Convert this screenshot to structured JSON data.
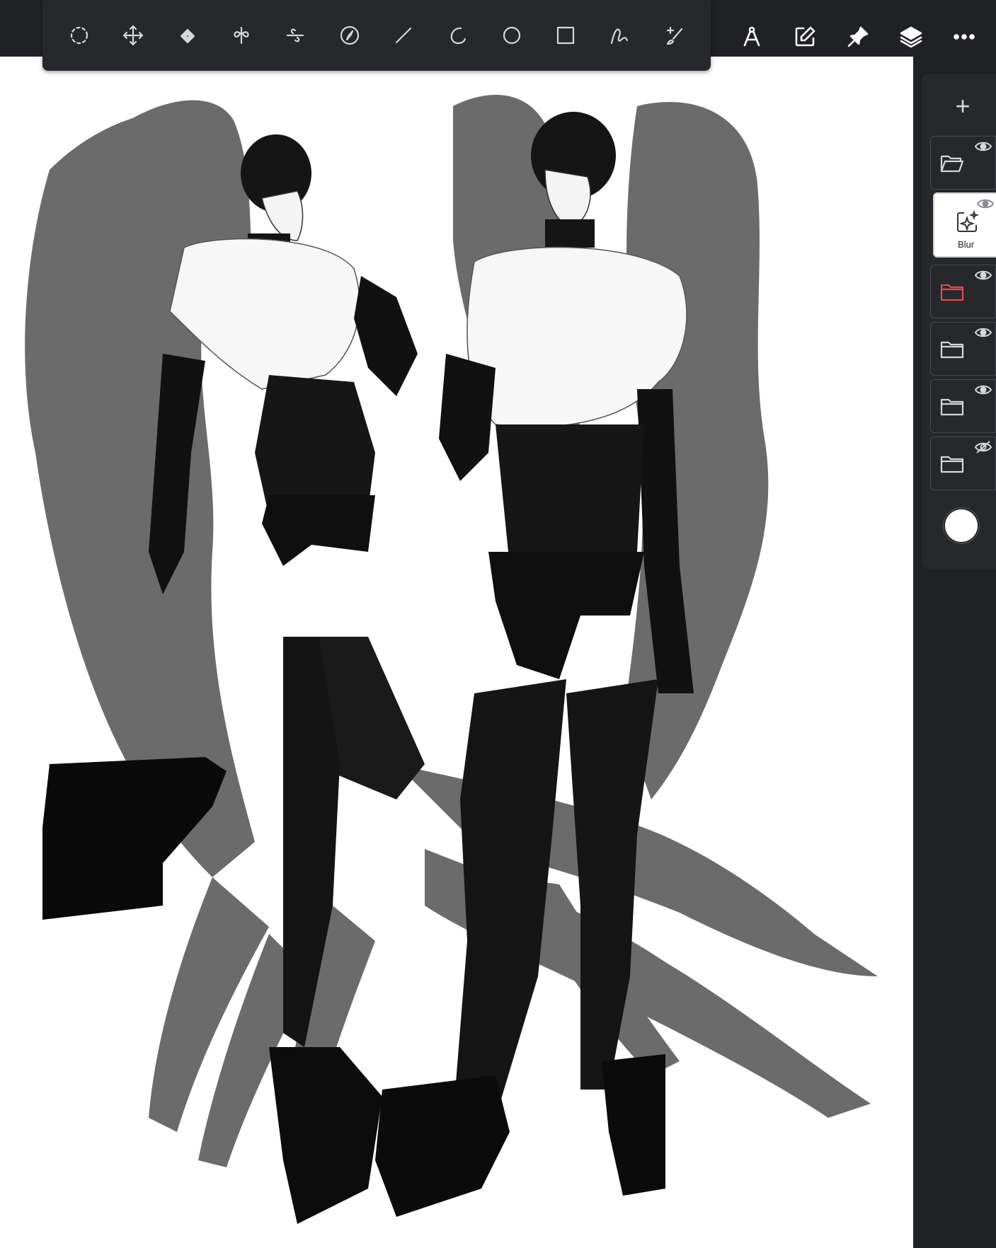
{
  "toolbar": {
    "tools": [
      {
        "name": "selection-lasso",
        "icon": "dashed-circle-icon"
      },
      {
        "name": "move",
        "icon": "move-arrows-icon"
      },
      {
        "name": "fill",
        "icon": "paint-bucket-icon"
      },
      {
        "name": "symmetry-vertical",
        "icon": "symmetry-icon"
      },
      {
        "name": "symmetry-radial",
        "icon": "radial-symmetry-icon"
      },
      {
        "name": "navigate",
        "icon": "compass-icon"
      },
      {
        "name": "line",
        "icon": "line-icon"
      },
      {
        "name": "arc",
        "icon": "arc-icon"
      },
      {
        "name": "ellipse",
        "icon": "circle-icon"
      },
      {
        "name": "rectangle",
        "icon": "square-icon"
      },
      {
        "name": "curve",
        "icon": "curve-icon"
      },
      {
        "name": "transform-brush",
        "icon": "brush-icon"
      }
    ]
  },
  "actions": [
    "ruler-icon",
    "edit-icon",
    "pin-icon",
    "layers-icon",
    "more-icon"
  ],
  "layers": {
    "add_label": "+",
    "items": [
      {
        "type": "folder-open",
        "visible": true,
        "color": "#d6d7da"
      },
      {
        "type": "filter",
        "label": "Blur",
        "visible": true,
        "selected": true
      },
      {
        "type": "folder",
        "visible": true,
        "color": "#e5484d"
      },
      {
        "type": "folder",
        "visible": true,
        "color": "#d6d7da"
      },
      {
        "type": "folder",
        "visible": true,
        "color": "#d6d7da"
      },
      {
        "type": "folder",
        "visible": false,
        "color": "#d6d7da"
      }
    ],
    "current_color": "#ffffff"
  },
  "colors": {
    "bar": "#202125",
    "panel": "#27282c",
    "icon": "#d6d7da",
    "accent_red": "#e5484d"
  }
}
